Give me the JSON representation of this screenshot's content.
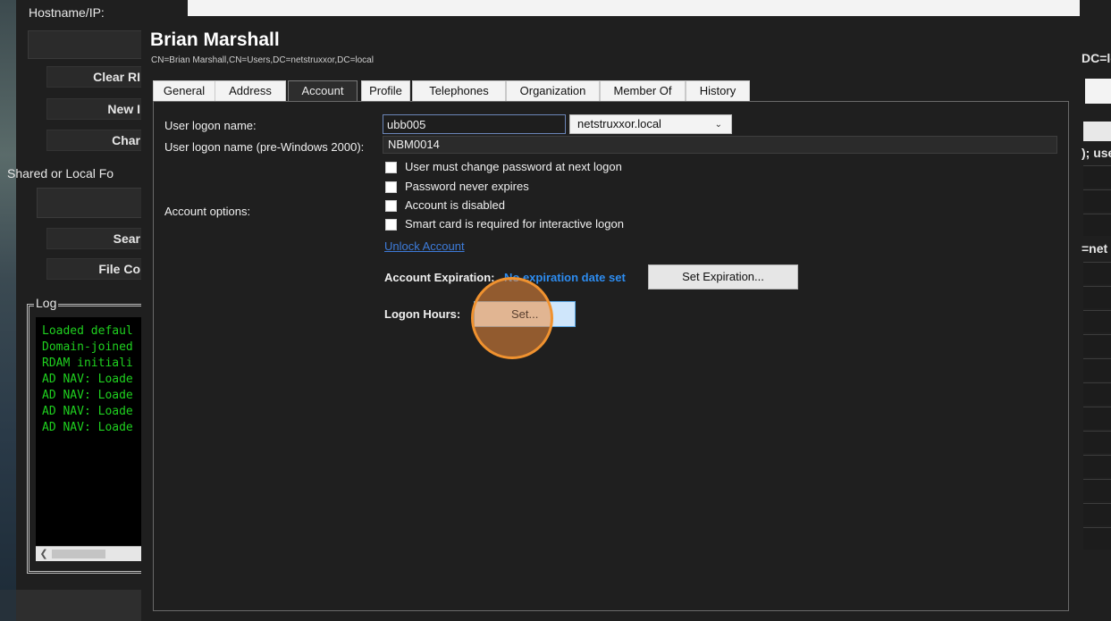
{
  "background_window": {
    "hostname_label": "Hostname/IP:",
    "buttons": [
      "Clear RI",
      "New I",
      "Char",
      "Sear",
      "File Co"
    ],
    "shared_folder_label": "Shared or Local Fo",
    "log_legend": "Log",
    "log_lines": [
      "Loaded defaul",
      "Domain-joined",
      "RDAM initiali",
      "AD NAV: Loade",
      "AD NAV: Loade",
      "AD NAV: Loade",
      "AD NAV: Loade"
    ],
    "log_color": "#1fd11f",
    "right_texts": [
      "DC=lo",
      "); use",
      "=net"
    ]
  },
  "dialog": {
    "title": "Brian Marshall",
    "distinguished_name": "CN=Brian Marshall,CN=Users,DC=netstruxxor,DC=local",
    "tabs": [
      "General",
      "Address",
      "Account",
      "Profile",
      "Telephones",
      "Organization",
      "Member Of",
      "History"
    ],
    "active_tab": "Account",
    "account": {
      "logon_name_label": "User logon name:",
      "logon_name_value": "ubb005",
      "domain_value": "netstruxxor.local",
      "prewin_label": "User logon name (pre-Windows 2000):",
      "prewin_value": "NBM0014",
      "account_options_label": "Account options:",
      "options": [
        {
          "label": "User must change password at next logon",
          "checked": false
        },
        {
          "label": "Password never expires",
          "checked": false
        },
        {
          "label": "Account is disabled",
          "checked": false
        },
        {
          "label": "Smart card is required for interactive logon",
          "checked": false
        }
      ],
      "unlock_link": "Unlock Account",
      "expiration_label": "Account Expiration:",
      "expiration_value": "No expiration date set",
      "set_expiration_button": "Set Expiration...",
      "logon_hours_label": "Logon Hours:",
      "set_hours_button": "Set..."
    }
  },
  "colors": {
    "dialog_bg": "#1f1f1f",
    "link": "#3d7bd9",
    "expiration_value": "#2d8cf0",
    "click_highlight": "#f0922f"
  }
}
